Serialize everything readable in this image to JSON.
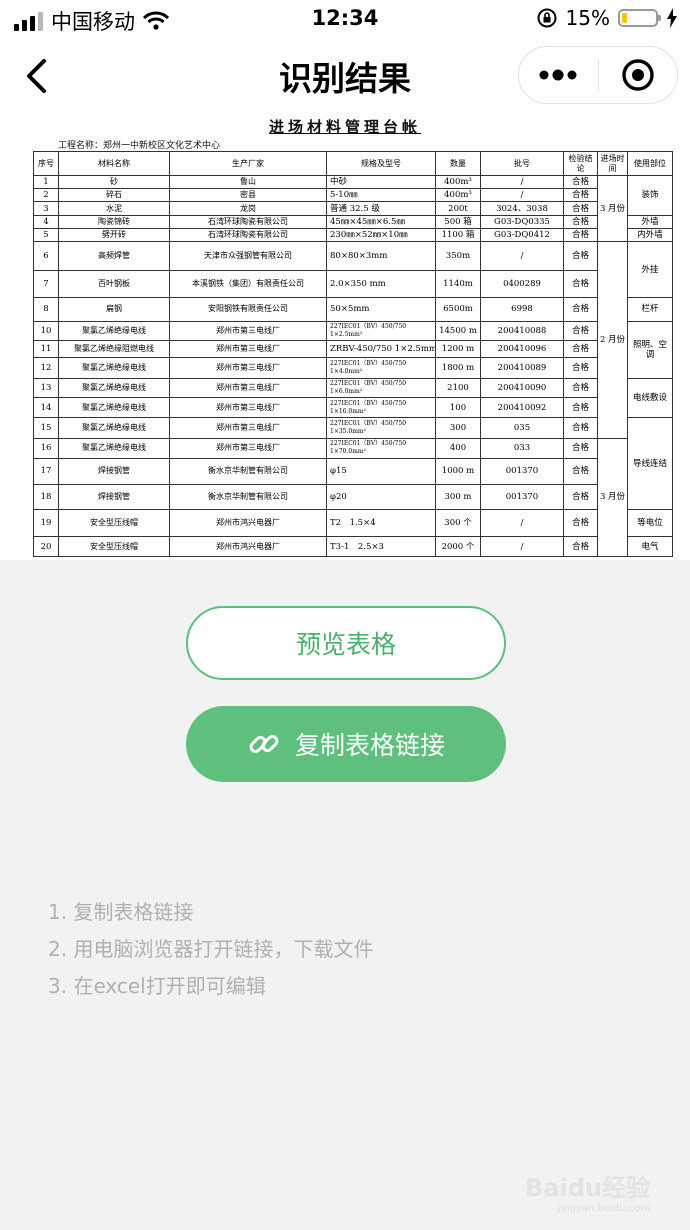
{
  "status_bar": {
    "carrier": "中国移动",
    "time": "12:34",
    "battery": "15%",
    "battery_level": 0.15
  },
  "nav": {
    "title": "识别结果"
  },
  "sheet": {
    "title": "进场材料管理台帐",
    "project": "工程名称：郑州一中新校区文化艺术中心",
    "headers": [
      "序号",
      "材料名称",
      "生产厂家",
      "规格及型号",
      "数量",
      "批号",
      "检验结论",
      "进场时间",
      "使用部位"
    ],
    "rows": [
      [
        "1",
        "砂",
        "鲁山",
        "中砂",
        "400m³",
        "/",
        "合格"
      ],
      [
        "2",
        "碎石",
        "密县",
        "5-10㎜",
        "400m³",
        "/",
        "合格"
      ],
      [
        "3",
        "水泥",
        "龙岗",
        "普通 32.5 级",
        "200t",
        "3024、3038",
        "合格"
      ],
      [
        "4",
        "陶瓷锦砖",
        "石湾环球陶瓷有限公司",
        "45㎜×45㎜×6.5㎜",
        "500 箱",
        "G03-DQ0335",
        "合格"
      ],
      [
        "5",
        "劈开砖",
        "石湾环球陶瓷有限公司",
        "230㎜×52㎜×10㎜",
        "1100 箱",
        "G03-DQ0412",
        "合格"
      ],
      [
        "6",
        "高频焊管",
        "天津市众强钢管有限公司",
        "80×80×3mm",
        "350m",
        "/",
        "合格"
      ],
      [
        "7",
        "百叶钢板",
        "本溪钢铁（集团）有限责任公司",
        "2.0×350 mm",
        "1140m",
        "0400289",
        "合格"
      ],
      [
        "8",
        "扁钢",
        "安阳钢铁有限责任公司",
        "50×5mm",
        "6500m",
        "6998",
        "合格"
      ],
      [
        "10",
        "聚氯乙烯绝缘电线",
        "郑州市第三电线厂",
        "227IEC01（BV）450/750 1×2.5mm²",
        "14500 m",
        "200410088",
        "合格"
      ],
      [
        "11",
        "聚氯乙烯绝缘阻燃电线",
        "郑州市第三电线厂",
        "ZRBV-450/750 1×2.5mm²",
        "1200 m",
        "200410096",
        "合格"
      ],
      [
        "12",
        "聚氯乙烯绝缘电线",
        "郑州市第三电线厂",
        "227IEC01（BV）450/750 1×4.0mm²",
        "1800 m",
        "200410089",
        "合格"
      ],
      [
        "13",
        "聚氯乙烯绝缘电线",
        "郑州市第三电线厂",
        "227IEC01（BV）450/750 1×6.0mm²",
        "2100",
        "200410090",
        "合格"
      ],
      [
        "14",
        "聚氯乙烯绝缘电线",
        "郑州市第三电线厂",
        "227IEC01（BV）450/750 1×16.0mm²",
        "100",
        "200410092",
        "合格"
      ],
      [
        "15",
        "聚氯乙烯绝缘电线",
        "郑州市第三电线厂",
        "227IEC01（BV）450/750 1×35.0mm²",
        "300",
        "035",
        "合格"
      ],
      [
        "16",
        "聚氯乙烯绝缘电线",
        "郑州市第三电线厂",
        "227IEC01（BV）450/750 1×70.0mm²",
        "400",
        "033",
        "合格"
      ],
      [
        "17",
        "焊接钢管",
        "衡水京华制管有限公司",
        "φ15",
        "1000 m",
        "001370",
        "合格"
      ],
      [
        "18",
        "焊接钢管",
        "衡水京华制管有限公司",
        "φ20",
        "300 m",
        "001370",
        "合格"
      ],
      [
        "19",
        "安全型压线帽",
        "郑州市鸿兴电器厂",
        "T2　1.5×4",
        "300 个",
        "/",
        "合格"
      ],
      [
        "20",
        "安全型压线帽",
        "郑州市鸿兴电器厂",
        "T3-1　2.5×3",
        "2000 个",
        "/",
        "合格"
      ]
    ],
    "time_groups": [
      "3 月份",
      "2 月份",
      "3 月份"
    ],
    "use_groups": [
      "装饰",
      "外墙",
      "内外墙",
      "外挂",
      "栏杆",
      "照明、空调",
      "电线敷设",
      "导线连结",
      "等电位",
      "电气"
    ]
  },
  "buttons": {
    "preview": "预览表格",
    "copy_link": "复制表格链接"
  },
  "steps": [
    "1. 复制表格链接",
    "2. 用电脑浏览器打开链接，下载文件",
    "3. 在excel打开即可编辑"
  ],
  "watermark": {
    "brand": "Baidu经验",
    "url": "jingyan.baidu.com"
  },
  "colors": {
    "accent": "#5fbf7d",
    "accent_text": "#4caf6e",
    "step_text": "#b0b0b0"
  },
  "icons": {
    "back": "chevron-left-icon",
    "more": "more-dots-icon",
    "close": "target-circle-icon",
    "link": "link-icon",
    "wifi": "wifi-icon",
    "lock": "rotation-lock-icon",
    "charging": "bolt-icon"
  }
}
